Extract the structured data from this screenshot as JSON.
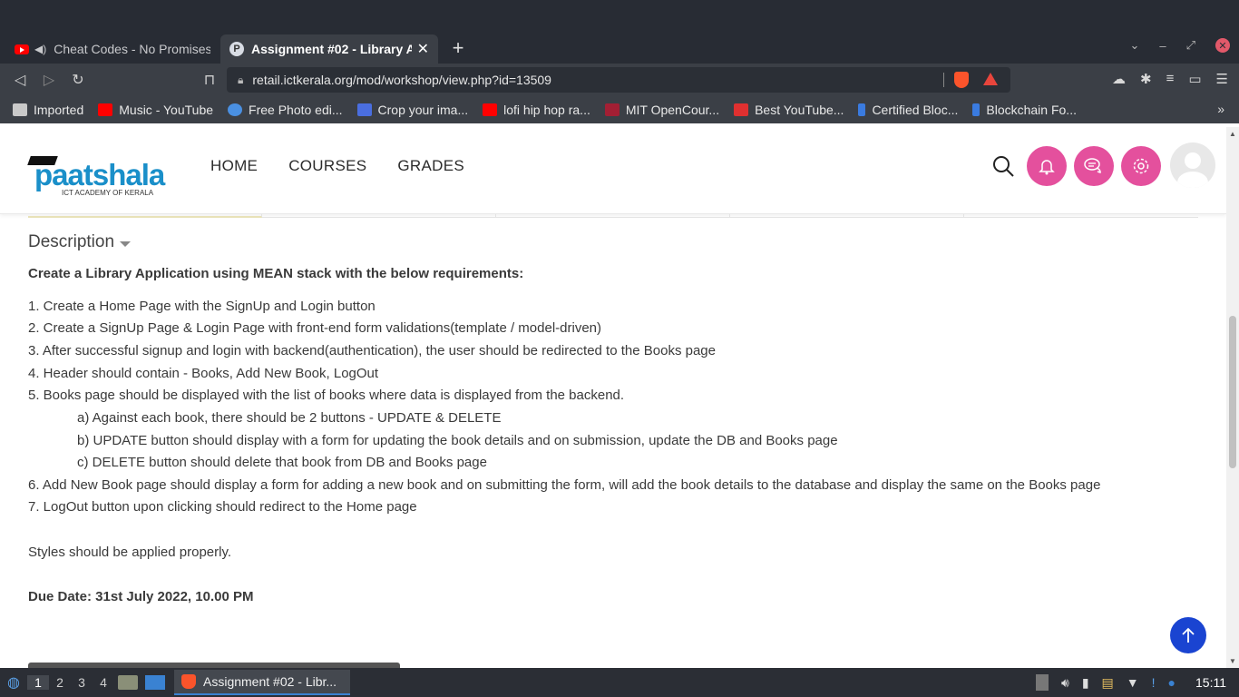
{
  "browser": {
    "tabs": [
      {
        "label": "Cheat Codes - No Promises",
        "active": false
      },
      {
        "label": "Assignment #02 - Library A",
        "active": true
      }
    ],
    "new_tab": "+",
    "url": "retail.ictkerala.org/mod/workshop/view.php?id=13509",
    "bookmarks": [
      {
        "label": "Imported",
        "icon": "folder-icon",
        "color": "#c9c9c9"
      },
      {
        "label": "Music - YouTube",
        "icon": "youtube-icon",
        "color": "#ff0000"
      },
      {
        "label": "Free Photo edi...",
        "icon": "photo-editor-icon",
        "color": "#4a90e2"
      },
      {
        "label": "Crop your ima...",
        "icon": "crop-icon",
        "color": "#4a6ee0"
      },
      {
        "label": "lofi hip hop ra...",
        "icon": "youtube-icon",
        "color": "#ff0000"
      },
      {
        "label": "MIT OpenCour...",
        "icon": "mit-icon",
        "color": "#a31f34"
      },
      {
        "label": "Best YouTube...",
        "icon": "best-icon",
        "color": "#e03030"
      },
      {
        "label": "Certified Bloc...",
        "icon": "blockchain-icon",
        "color": "#3a7be0"
      },
      {
        "label": "Blockchain Fo...",
        "icon": "blockchain-icon",
        "color": "#3a7be0"
      }
    ],
    "more": "»"
  },
  "site": {
    "logo_text": "paatshala",
    "logo_sub": "ICT ACADEMY OF KERALA",
    "nav": [
      "HOME",
      "COURSES",
      "GRADES"
    ],
    "accent": "#e4509d"
  },
  "description": {
    "heading": "Description",
    "title": "Create a Library Application using MEAN stack with the below requirements:",
    "items": [
      "1. Create a Home Page with the SignUp and Login button",
      "2. Create a SignUp Page & Login Page with front-end form validations(template / model-driven)",
      "3. After successful signup and login with backend(authentication), the user should be redirected to the Books page",
      "4. Header should contain - Books, Add New Book, LogOut",
      "5. Books page should be displayed with the list of books where data is displayed from the backend.",
      "a) Against each book, there should be 2 buttons - UPDATE & DELETE",
      "b) UPDATE button should display with a form for updating the book details and on submission, update the DB and Books page",
      "c) DELETE button should delete that book from DB and Books page",
      "6. Add New Book page should display a form for adding a new book and on submitting the form, will add the book details to the database and display the same on the Books page",
      "7. LogOut button upon clicking should redirect to the Home page"
    ],
    "styles_note": "Styles should be applied properly.",
    "due_date": "Due Date: 31st July 2022,  10.00 PM"
  },
  "taskbar": {
    "workspaces": [
      "1",
      "2",
      "3",
      "4"
    ],
    "active_window": "Assignment #02 - Libr...",
    "clock": "15:11"
  }
}
